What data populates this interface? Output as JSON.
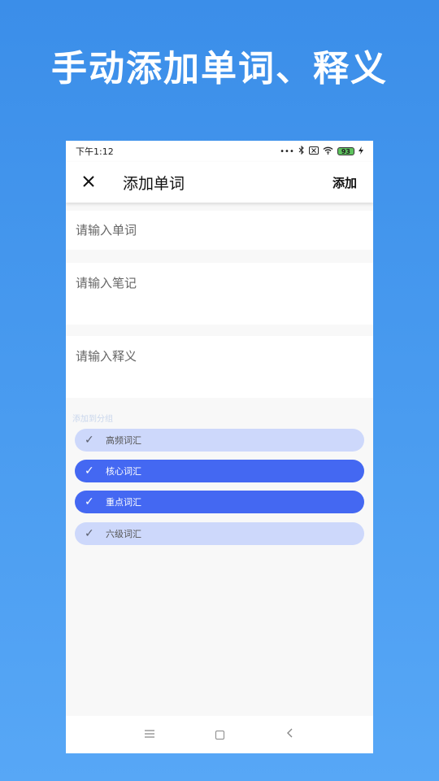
{
  "headline": "手动添加单词、释义",
  "status_bar": {
    "time": "下午1:12",
    "icons": [
      "more-dots-icon",
      "bluetooth-icon",
      "no-sim-icon",
      "wifi-icon",
      "battery-icon",
      "charging-icon"
    ],
    "battery_level": "93"
  },
  "toolbar": {
    "close_icon": "close-icon",
    "title": "添加单词",
    "add_label": "添加"
  },
  "form": {
    "word_placeholder": "请输入单词",
    "note_placeholder": "请输入笔记",
    "definition_placeholder": "请输入释义"
  },
  "section_label": "添加到分组",
  "groups": [
    {
      "label": "高频词汇",
      "selected": false
    },
    {
      "label": "核心词汇",
      "selected": true
    },
    {
      "label": "重点词汇",
      "selected": true
    },
    {
      "label": "六级词汇",
      "selected": false
    }
  ],
  "colors": {
    "background_top": "#3b8ee9",
    "background_bottom": "#57a7f6",
    "chip_selected": "#4468f2",
    "chip_unselected": "#cdd8fb"
  },
  "nav_bar": {
    "icons": [
      "menu-icon",
      "home-icon",
      "back-icon"
    ]
  }
}
